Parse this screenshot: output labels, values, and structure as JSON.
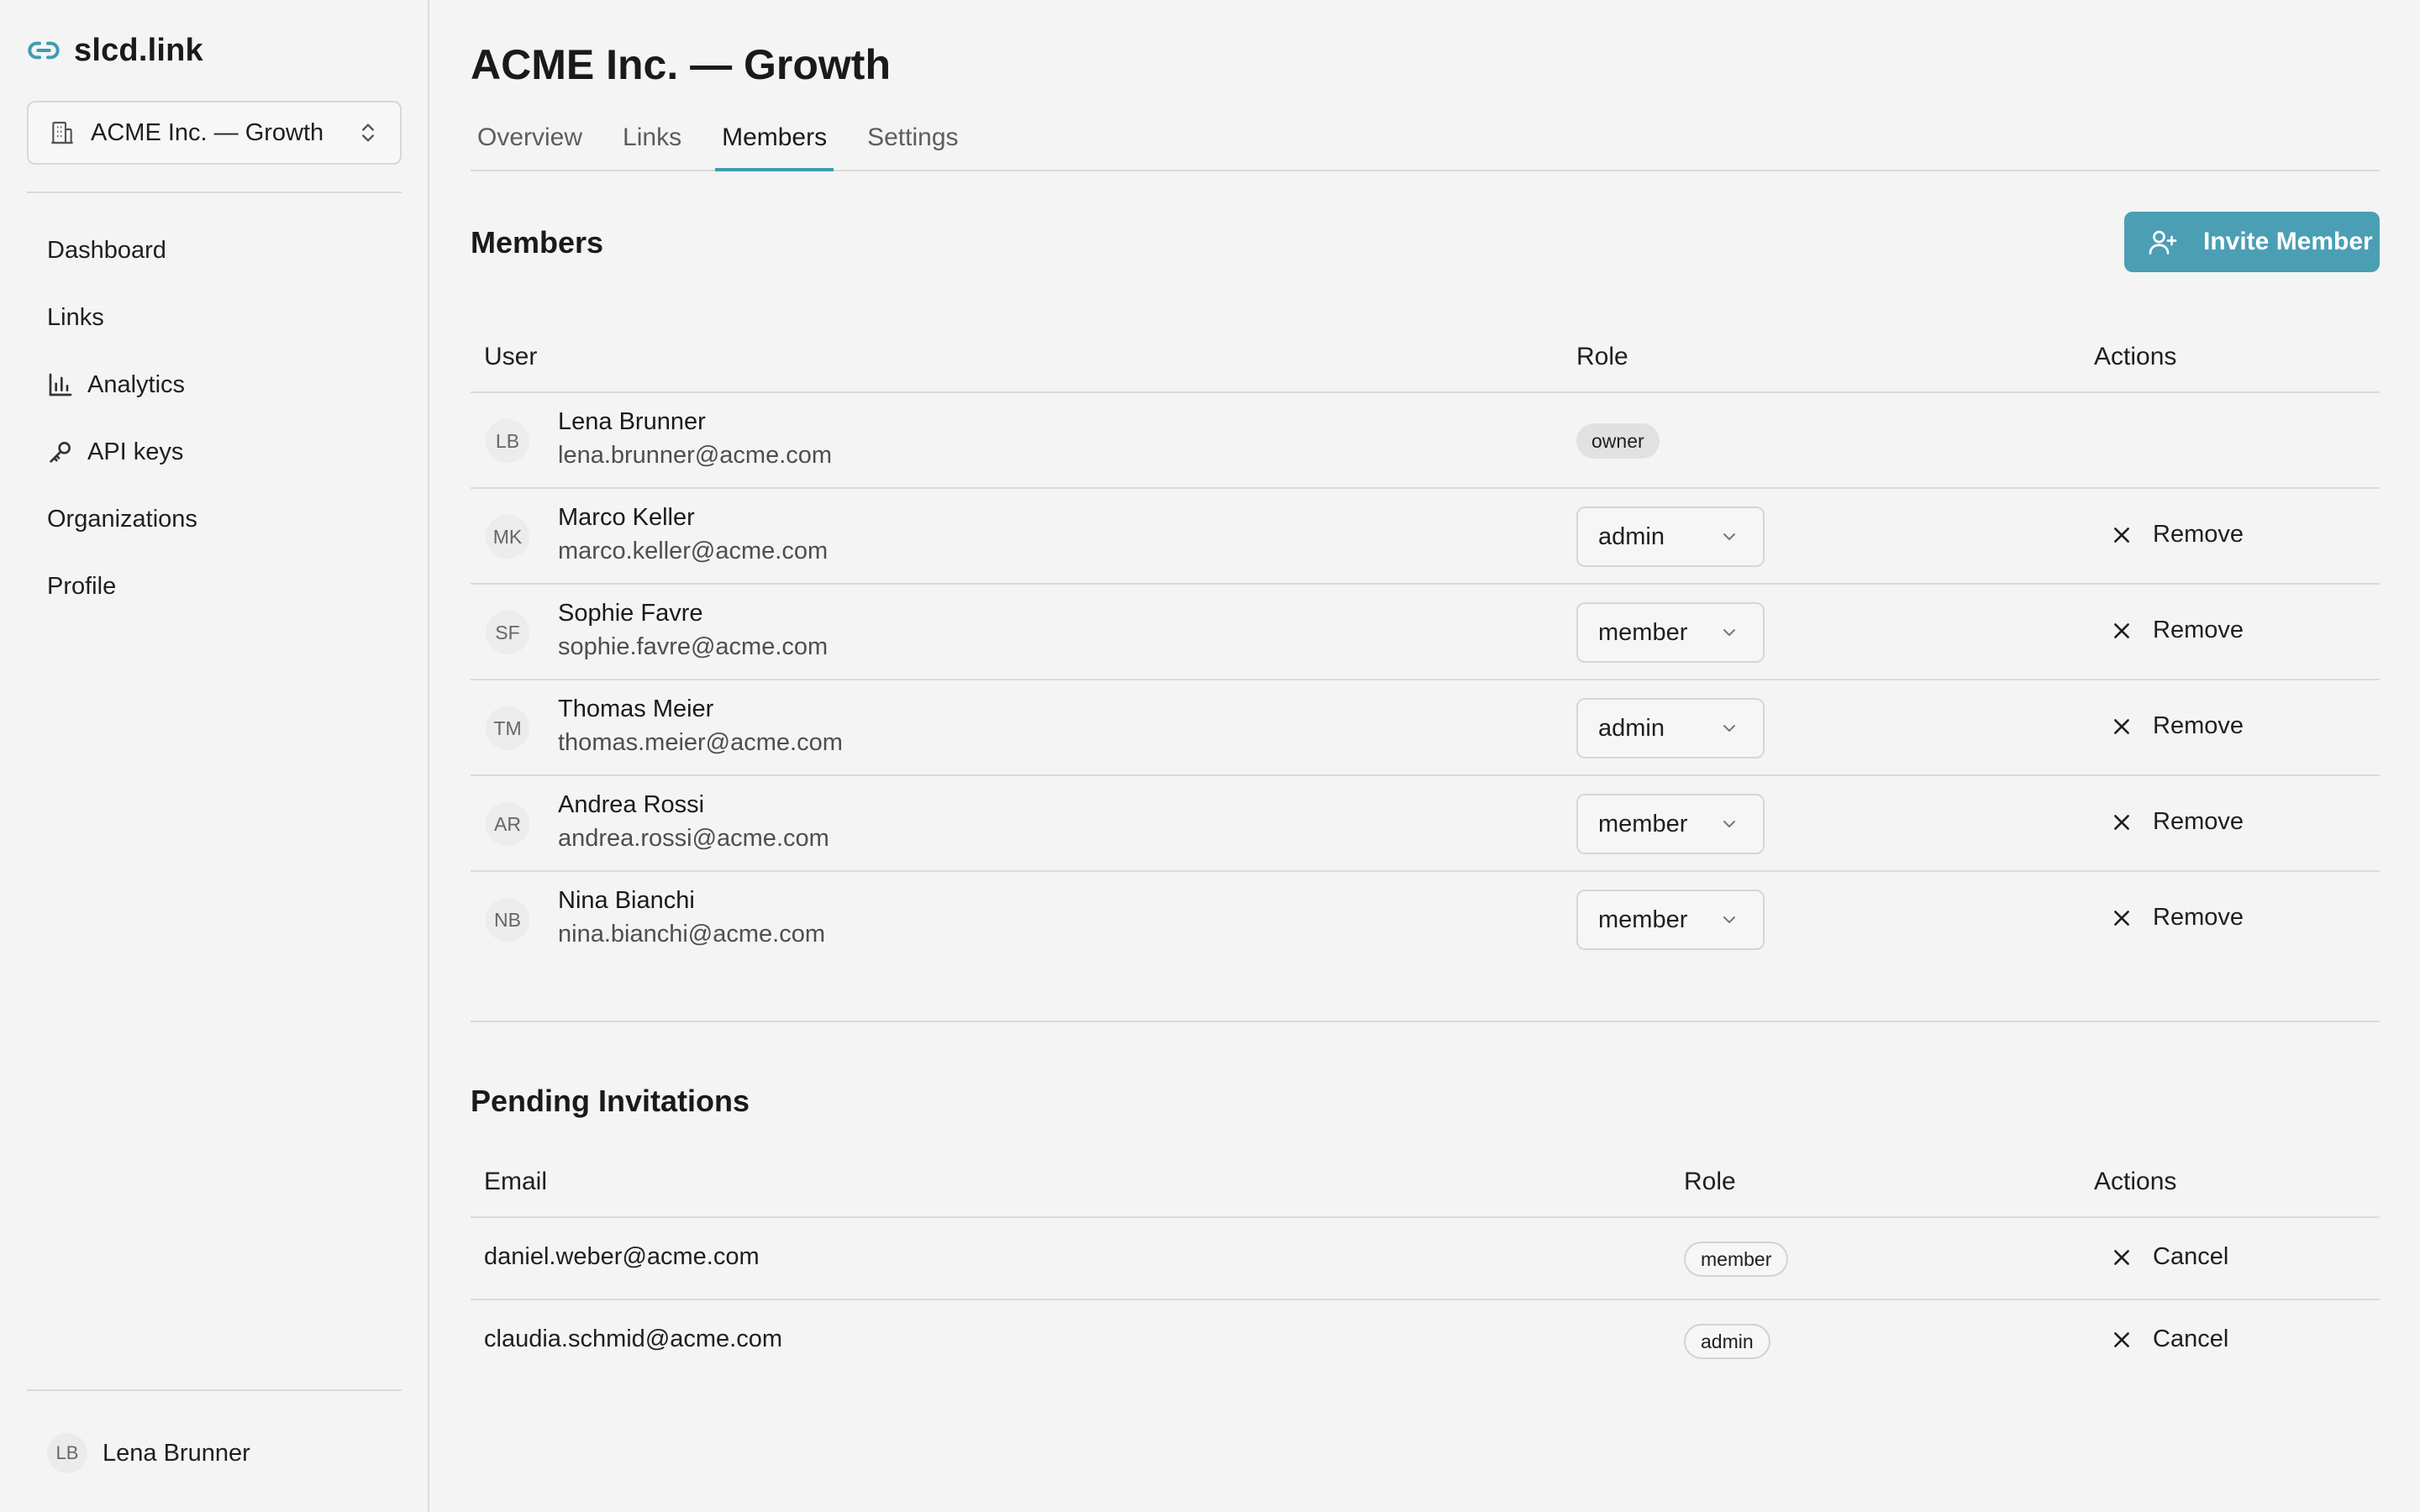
{
  "brand": {
    "name": "slcd.link",
    "icon": "link-icon"
  },
  "org_switcher": {
    "name": "ACME Inc. — Growth"
  },
  "sidebar": {
    "items": [
      {
        "label": "Dashboard",
        "icon": ""
      },
      {
        "label": "Links",
        "icon": ""
      },
      {
        "label": "Analytics",
        "icon": "bar-chart-icon"
      },
      {
        "label": "API keys",
        "icon": "key-icon"
      },
      {
        "label": "Organizations",
        "icon": ""
      },
      {
        "label": "Profile",
        "icon": ""
      }
    ],
    "user": {
      "initials": "LB",
      "name": "Lena Brunner"
    }
  },
  "page": {
    "title": "ACME Inc. — Growth"
  },
  "tabs": [
    {
      "label": "Overview",
      "active": false
    },
    {
      "label": "Links",
      "active": false
    },
    {
      "label": "Members",
      "active": true
    },
    {
      "label": "Settings",
      "active": false
    }
  ],
  "members": {
    "title": "Members",
    "invite_label": "Invite Member",
    "columns": {
      "user": "User",
      "role": "Role",
      "actions": "Actions"
    },
    "rows": [
      {
        "initials": "LB",
        "name": "Lena Brunner",
        "email": "lena.brunner@acme.com",
        "role": "owner",
        "editable": false,
        "action": ""
      },
      {
        "initials": "MK",
        "name": "Marco Keller",
        "email": "marco.keller@acme.com",
        "role": "admin",
        "editable": true,
        "action": "Remove"
      },
      {
        "initials": "SF",
        "name": "Sophie Favre",
        "email": "sophie.favre@acme.com",
        "role": "member",
        "editable": true,
        "action": "Remove"
      },
      {
        "initials": "TM",
        "name": "Thomas Meier",
        "email": "thomas.meier@acme.com",
        "role": "admin",
        "editable": true,
        "action": "Remove"
      },
      {
        "initials": "AR",
        "name": "Andrea Rossi",
        "email": "andrea.rossi@acme.com",
        "role": "member",
        "editable": true,
        "action": "Remove"
      },
      {
        "initials": "NB",
        "name": "Nina Bianchi",
        "email": "nina.bianchi@acme.com",
        "role": "member",
        "editable": true,
        "action": "Remove"
      }
    ]
  },
  "invitations": {
    "title": "Pending Invitations",
    "columns": {
      "email": "Email",
      "role": "Role",
      "actions": "Actions"
    },
    "rows": [
      {
        "email": "daniel.weber@acme.com",
        "role": "member",
        "action": "Cancel"
      },
      {
        "email": "claudia.schmid@acme.com",
        "role": "admin",
        "action": "Cancel"
      }
    ]
  },
  "colors": {
    "accent": "#4b9fb4",
    "tab_underline": "#3e9cb3",
    "background": "#f4f4f4"
  }
}
